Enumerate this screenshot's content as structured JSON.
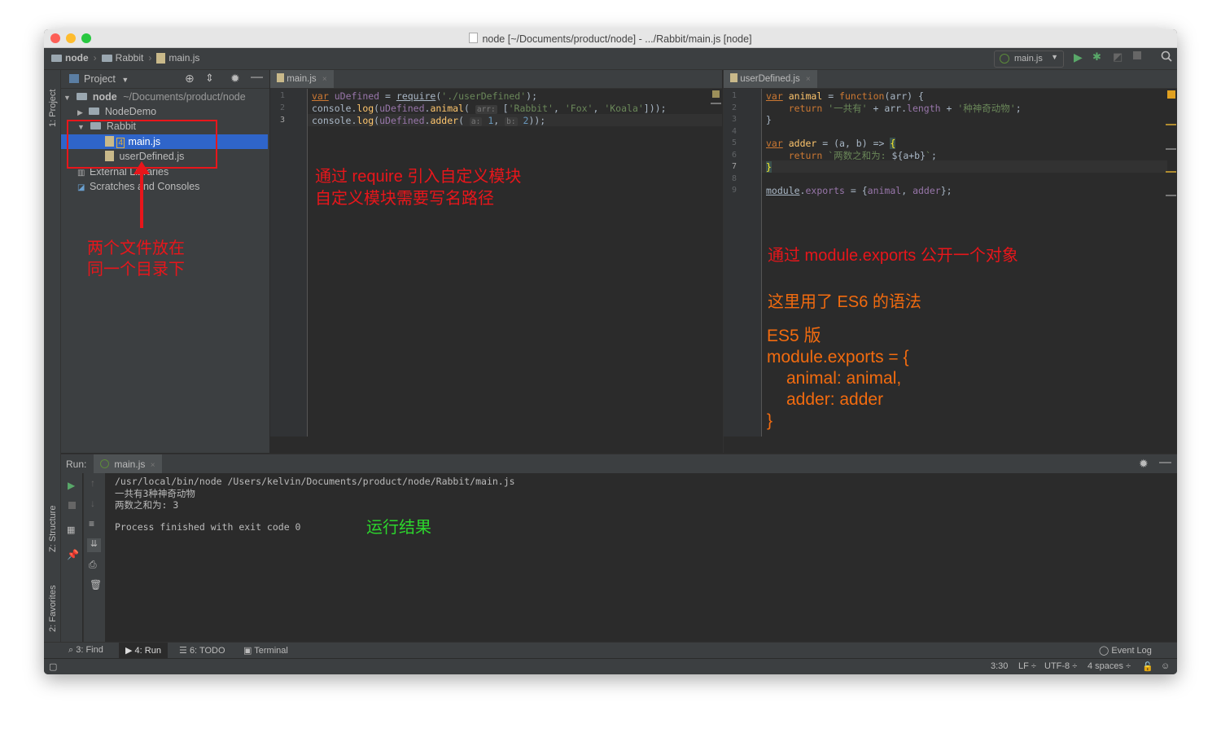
{
  "window": {
    "title": "node [~/Documents/product/node] - .../Rabbit/main.js [node]"
  },
  "breadcrumb": {
    "items": [
      "node",
      "Rabbit",
      "main.js"
    ]
  },
  "toolbar": {
    "run_config": "main.js"
  },
  "side_stripe": {
    "project": "1: Project",
    "structure": "Z: Structure",
    "favorites": "2: Favorites"
  },
  "project_panel": {
    "title": "Project",
    "root_name": "node",
    "root_path": "~/Documents/product/node",
    "items": [
      {
        "label": "NodeDemo"
      },
      {
        "label": "Rabbit"
      },
      {
        "label": "main.js",
        "badge": "4"
      },
      {
        "label": "userDefined.js"
      },
      {
        "label": "External Libraries"
      },
      {
        "label": "Scratches and Consoles"
      }
    ],
    "annotation_line1": "两个文件放在",
    "annotation_line2": "同一个目录下"
  },
  "editor_left": {
    "tab": "main.js",
    "line_numbers": [
      "1",
      "2",
      "3"
    ],
    "annotation_line1": "通过 require 引入自定义模块",
    "annotation_line2": "自定义模块需要写名路径"
  },
  "editor_right": {
    "tab": "userDefined.js",
    "line_numbers": [
      "1",
      "2",
      "3",
      "4",
      "5",
      "6",
      "7",
      "8",
      "9"
    ],
    "annotation1": "通过 module.exports 公开一个对象",
    "annotation2": "这里用了 ES6 的语法",
    "es5_title": "ES5 版",
    "es5_line1": "module.exports = {",
    "es5_line2": "animal: animal,",
    "es5_line3": "adder: adder",
    "es5_line4": "}"
  },
  "run_panel": {
    "label": "Run:",
    "tab": "main.js",
    "output": [
      "/usr/local/bin/node /Users/kelvin/Documents/product/node/Rabbit/main.js",
      "一共有3种神奇动物",
      "两数之和为: 3",
      "",
      "Process finished with exit code 0"
    ],
    "annotation": "运行结果"
  },
  "bottom_tools": {
    "find": "3: Find",
    "run": "4: Run",
    "todo": "6: TODO",
    "terminal": "Terminal",
    "event_log": "Event Log"
  },
  "status": {
    "position": "3:30",
    "line_sep": "LF ÷",
    "encoding": "UTF-8 ÷",
    "indent": "4 spaces ÷"
  },
  "colors": {
    "bg": "#2b2b2b",
    "panel": "#3c3f41",
    "selection": "#2f65ca",
    "annotation_red": "#e8161b",
    "annotation_orange": "#f26b0f",
    "annotation_green": "#2cd62c"
  }
}
